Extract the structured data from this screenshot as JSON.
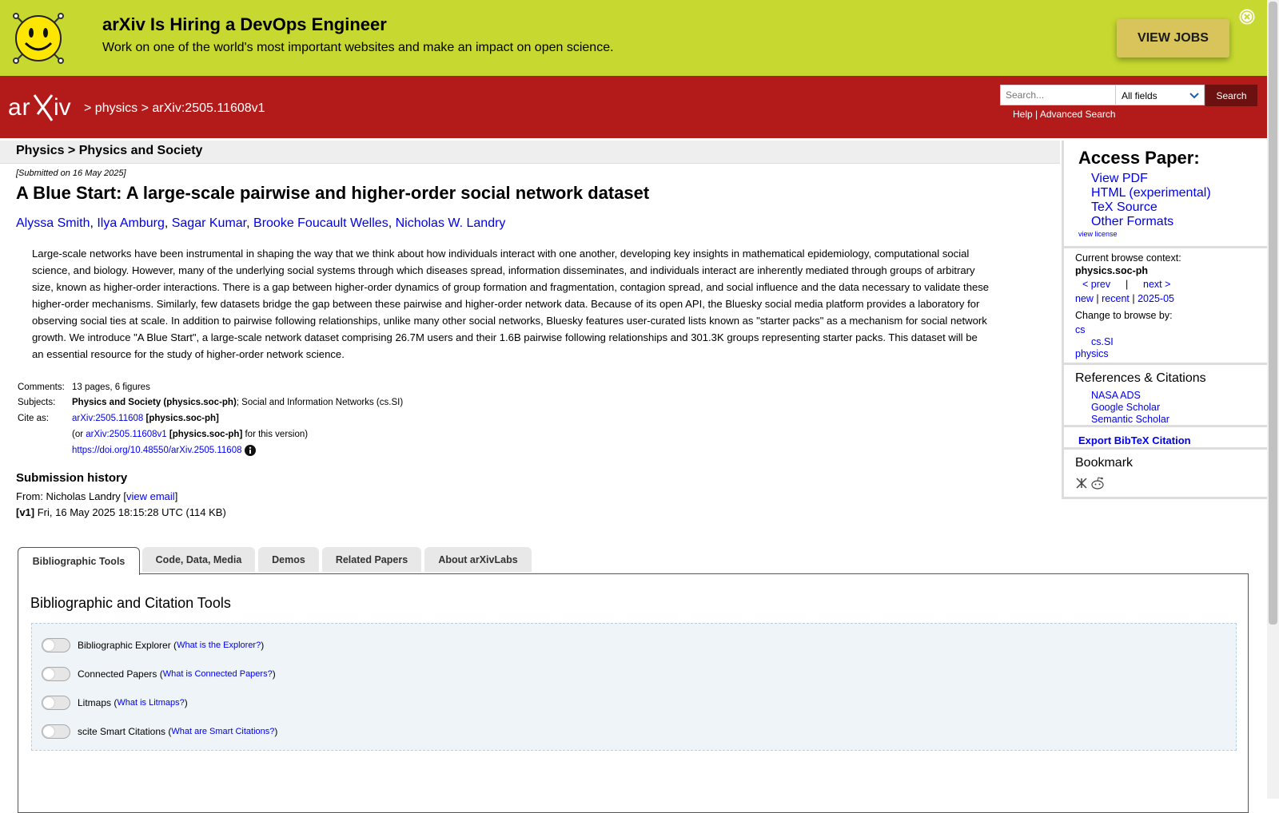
{
  "banner": {
    "title": "arXiv Is Hiring a DevOps Engineer",
    "text": "Work on one of the world's most important websites and make an impact on open science.",
    "cta_label": "VIEW JOBS"
  },
  "header": {
    "logo_text": "arXiv",
    "breadcrumb": [
      " > ",
      "physics",
      " > ",
      "arXiv:2505.11608v1"
    ],
    "search_placeholder": "Search...",
    "search_field_value": "All fields",
    "search_button": "Search",
    "help_link": "Help",
    "separator": " | ",
    "advanced_link": "Advanced Search"
  },
  "subject_bar": "Physics > Physics and Society",
  "paper": {
    "dateline": "[Submitted on 16 May 2025]",
    "title": "A Blue Start: A large-scale pairwise and higher-order social network dataset",
    "authors": [
      "Alyssa Smith",
      "Ilya Amburg",
      "Sagar Kumar",
      "Brooke Foucault Welles",
      "Nicholas W. Landry"
    ],
    "abstract_lines": [
      "Large-scale networks have been instrumental in shaping the way that we think about how individuals interact with one another, developing key insights in mathematical epidemiology, computational social",
      "science, and biology. However, many of the underlying social systems through which diseases spread, information disseminates, and individuals interact are inherently mediated through groups of arbitrary",
      "size, known as higher-order interactions. There is a gap between higher-order dynamics of group formation and fragmentation, contagion spread, and social influence and the data necessary to validate these",
      "higher-order mechanisms. Similarly, few datasets bridge the gap between these pairwise and higher-order network data. Because of its open API, the Bluesky social media platform provides a laboratory for",
      "observing social ties at scale. In addition to pairwise following relationships, unlike many other social networks, Bluesky features user-curated lists known as \"starter packs\" as a mechanism for social network",
      "growth. We introduce \"A Blue Start\", a large-scale network dataset comprising 26.7M users and their 1.6B pairwise following relationships and 301.3K groups representing starter packs. This dataset will be",
      "an essential resource for the study of higher-order network science."
    ],
    "comments_label": "Comments:",
    "comments": "13 pages, 6 figures",
    "subjects_label": "Subjects:",
    "subjects_primary": "Physics and Society (physics.soc-ph)",
    "subjects_rest": "; Social and Information Networks (cs.SI)",
    "cite_label": "Cite as:",
    "cite_id": "arXiv:2505.11608",
    "cite_cat": " [physics.soc-ph]",
    "cite_or": "(or ",
    "cite_version_id": "arXiv:2505.11608v1",
    "cite_version_cat": " [physics.soc-ph]",
    "cite_version_suffix": " for this version)",
    "doi": "https://doi.org/10.48550/arXiv.2505.11608"
  },
  "history": {
    "title": "Submission history",
    "from_prefix": "From: Nicholas Landry [",
    "view_email": "view email",
    "from_suffix": "]",
    "v1_label": "[v1]",
    "v1_text": " Fri, 16 May 2025 18:15:28 UTC (114 KB)"
  },
  "tabs": [
    "Bibliographic Tools",
    "Code, Data, Media",
    "Demos",
    "Related Papers",
    "About arXivLabs"
  ],
  "tools": {
    "title": "Bibliographic and Citation Tools",
    "items": [
      {
        "label": "Bibliographic Explorer (",
        "link": "What is the Explorer?",
        "end": ")"
      },
      {
        "label": "Connected Papers (",
        "link": "What is Connected Papers?",
        "end": ")"
      },
      {
        "label": "Litmaps (",
        "link": "What is Litmaps?",
        "end": ")"
      },
      {
        "label": "scite Smart Citations (",
        "link": "What are Smart Citations?",
        "end": ")"
      }
    ]
  },
  "sidebar": {
    "access_title": "Access Paper:",
    "access_links": [
      "View PDF",
      "HTML (experimental)",
      "TeX Source",
      "Other Formats"
    ],
    "view_license": "view license",
    "context_label": "Current browse context:",
    "context_value": "physics.soc-ph",
    "prev": "< prev",
    "pipe": "|",
    "next": "next >",
    "new": "new",
    "recent": "recent",
    "month": "2025-05",
    "change_label": "Change to browse by:",
    "browse_cs": "cs",
    "browse_cs_si": "cs.SI",
    "browse_physics": "physics",
    "refs_title": "References & Citations",
    "refs": [
      "NASA ADS",
      "Google Scholar",
      "Semantic Scholar"
    ],
    "export_bibtex": "Export BibTeX Citation",
    "bookmark_title": "Bookmark"
  },
  "colors": {
    "banner_bg": "#c7d930",
    "header_bg": "#b31b1b",
    "link": "#0000ee"
  }
}
